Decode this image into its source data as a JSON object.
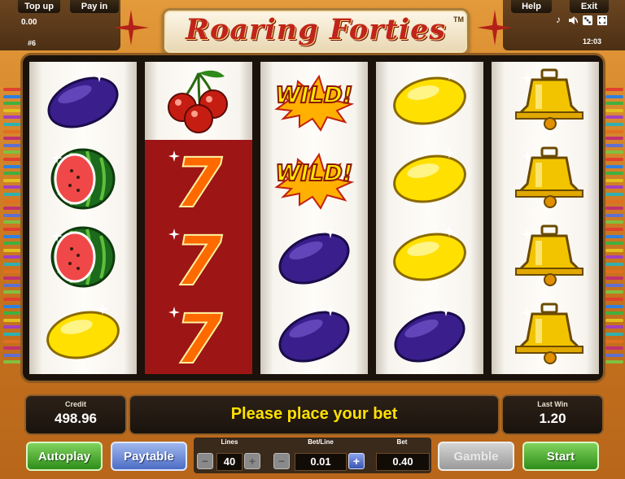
{
  "topbar": {
    "top_up": "Top up",
    "pay_in": "Pay in",
    "help": "Help",
    "exit": "Exit",
    "balance": "0.00",
    "game_number": "#6",
    "clock": "12:03"
  },
  "title": {
    "text": "Roaring Forties",
    "tm": "TM"
  },
  "reels": [
    [
      "plum",
      "melon",
      "melon",
      "lemon"
    ],
    [
      "cherries",
      "seven",
      "seven",
      "seven"
    ],
    [
      "wild",
      "wild",
      "plum",
      "plum"
    ],
    [
      "lemon",
      "lemon",
      "lemon",
      "plum"
    ],
    [
      "bell",
      "bell",
      "bell",
      "bell"
    ]
  ],
  "symbol_text": {
    "wild": "WILD!",
    "seven": "7"
  },
  "credit": {
    "label": "Credit",
    "value": "498.96"
  },
  "message": "Please place your bet",
  "last_win": {
    "label": "Last Win",
    "value": "1.20"
  },
  "buttons": {
    "autoplay": "Autoplay",
    "paytable": "Paytable",
    "gamble": "Gamble",
    "start": "Start"
  },
  "controls": {
    "lines_label": "Lines",
    "lines_value": "40",
    "betline_label": "Bet/Line",
    "betline_value": "0.01",
    "bet_label": "Bet",
    "bet_value": "0.40",
    "minus": "−",
    "plus": "+"
  },
  "colors": {
    "frame": "#d7892e",
    "message_text": "#ffe000",
    "title_text": "#c0241a",
    "seven_reel_bg": "#9d1515",
    "start_button": "#2f8d1a",
    "paytable_button": "#4d6dc4"
  },
  "icons": {
    "sound": "music-note-icon",
    "speaker": "speaker-icon",
    "settings": "dice-icon",
    "fullscreen": "fullscreen-icon"
  }
}
